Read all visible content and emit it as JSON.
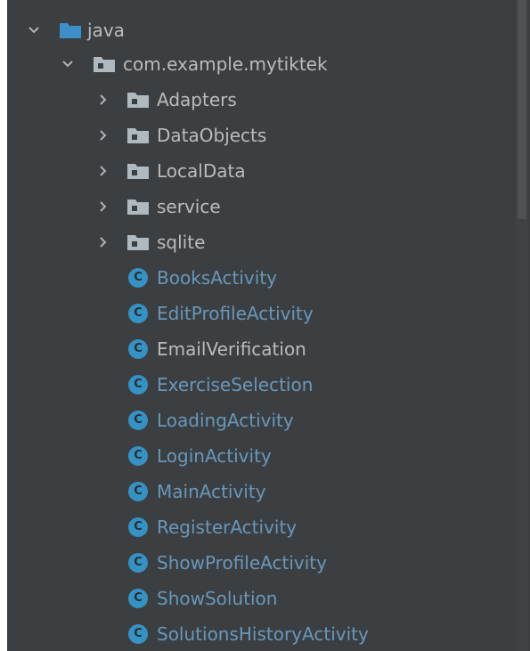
{
  "tree": {
    "root": {
      "label": "java",
      "expanded": true,
      "icon": "folder-icon"
    },
    "package": {
      "label": "com.example.mytiktek",
      "expanded": true,
      "icon": "package-folder-icon"
    },
    "subpackages": [
      {
        "label": "Adapters",
        "expanded": false
      },
      {
        "label": "DataObjects",
        "expanded": false
      },
      {
        "label": "LocalData",
        "expanded": false
      },
      {
        "label": "service",
        "expanded": false
      },
      {
        "label": "sqlite",
        "expanded": false
      }
    ],
    "classes": [
      {
        "label": "BooksActivity",
        "icon_letter": "C",
        "color": "#6897bb"
      },
      {
        "label": "EditProfileActivity",
        "icon_letter": "C",
        "color": "#6897bb"
      },
      {
        "label": "EmailVerification",
        "icon_letter": "C",
        "color": "#bbbbbb"
      },
      {
        "label": "ExerciseSelection",
        "icon_letter": "C",
        "color": "#6897bb"
      },
      {
        "label": "LoadingActivity",
        "icon_letter": "C",
        "color": "#6897bb"
      },
      {
        "label": "LoginActivity",
        "icon_letter": "C",
        "color": "#6897bb"
      },
      {
        "label": "MainActivity",
        "icon_letter": "C",
        "color": "#6897bb"
      },
      {
        "label": "RegisterActivity",
        "icon_letter": "C",
        "color": "#6897bb"
      },
      {
        "label": "ShowProfileActivity",
        "icon_letter": "C",
        "color": "#6897bb"
      },
      {
        "label": "ShowSolution",
        "icon_letter": "C",
        "color": "#6897bb"
      },
      {
        "label": "SolutionsHistoryActivity",
        "icon_letter": "C",
        "color": "#6897bb"
      }
    ]
  },
  "colors": {
    "background": "#3c3f41",
    "folder_blue": "#3d8ec9",
    "package_folder": "#aeb9c0",
    "class_icon": "#3592c4",
    "text_default": "#bbbbbb",
    "text_modified": "#6897bb"
  }
}
